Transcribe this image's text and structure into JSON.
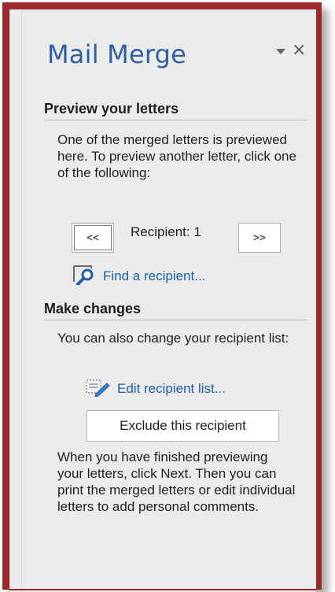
{
  "pane": {
    "title": "Mail Merge",
    "close_glyph": "×",
    "dropdown_icon": "chevron-down-icon",
    "close_icon": "close-icon"
  },
  "preview": {
    "heading": "Preview your letters",
    "intro": "One of the merged letters is previewed here. To preview another letter, click one of the following:",
    "prev_label": "<<",
    "next_label": ">>",
    "recipient_text": "Recipient: 1",
    "find_link": "Find a recipient...",
    "find_icon": "find-recipient-icon"
  },
  "changes": {
    "heading": "Make changes",
    "intro": "You can also change your recipient list:",
    "edit_link": "Edit recipient list...",
    "edit_icon": "edit-list-icon",
    "exclude_button": "Exclude this recipient",
    "finish_text": "When you have finished previewing your letters, click Next. Then you can print the merged letters or edit individual letters to add personal comments."
  },
  "colors": {
    "frame_border": "#9c2a2a",
    "title": "#2e5f9e",
    "link": "#1d5ea8",
    "panel_bg": "#ebebeb"
  }
}
